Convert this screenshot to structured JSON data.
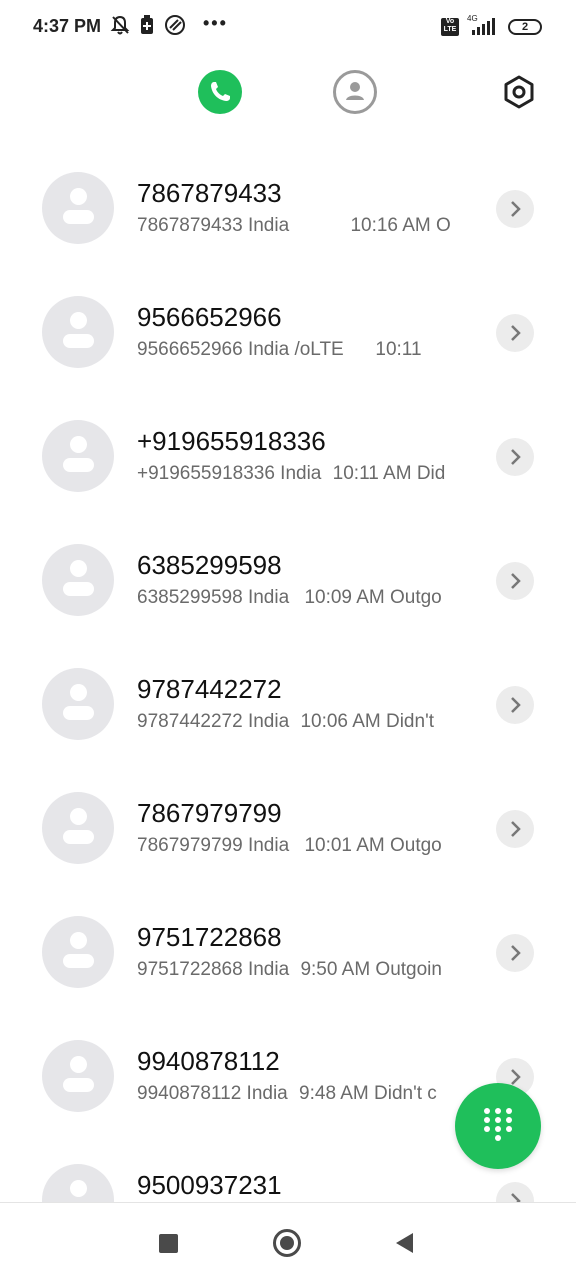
{
  "status_bar": {
    "time": "4:37 PM",
    "overflow_dots": "•••",
    "volte_label": "Vo LTE",
    "network_label": "4G",
    "battery_level": "2"
  },
  "top_nav": {
    "items": [
      {
        "name": "phone-tab",
        "icon": "phone-icon",
        "active": true
      },
      {
        "name": "contacts-tab",
        "icon": "contact-icon",
        "active": false
      },
      {
        "name": "settings-button",
        "icon": "settings-hexagon-icon",
        "active": false
      }
    ],
    "accent_color": "#1fbf5b"
  },
  "calls": [
    {
      "number": "7867879433",
      "location": "7867879433 India",
      "detail": "10:16 AM O"
    },
    {
      "number": "9566652966",
      "location": "9566652966 India",
      "detail": "/oLTE      10:11"
    },
    {
      "number": "+919655918336",
      "location": "+919655918336 India",
      "detail": "10:11 AM Did"
    },
    {
      "number": "6385299598",
      "location": "6385299598 India",
      "detail": "10:09 AM Outgo"
    },
    {
      "number": "9787442272",
      "location": "9787442272 India",
      "detail": "10:06 AM Didn't"
    },
    {
      "number": "7867979799",
      "location": "7867979799 India",
      "detail": "10:01 AM Outgo"
    },
    {
      "number": "9751722868",
      "location": "9751722868 India",
      "detail": "9:50 AM Outgoin"
    },
    {
      "number": "9940878112",
      "location": "9940878112 India",
      "detail": "9:48 AM Didn't c"
    },
    {
      "number": "9500937231",
      "location": "",
      "detail": ""
    }
  ],
  "fab": {
    "icon": "dialpad-icon"
  },
  "bottom_nav": {
    "items": [
      {
        "name": "recents-button",
        "icon": "square-icon"
      },
      {
        "name": "home-button",
        "icon": "circle-icon"
      },
      {
        "name": "back-button",
        "icon": "back-triangle-icon"
      }
    ]
  }
}
